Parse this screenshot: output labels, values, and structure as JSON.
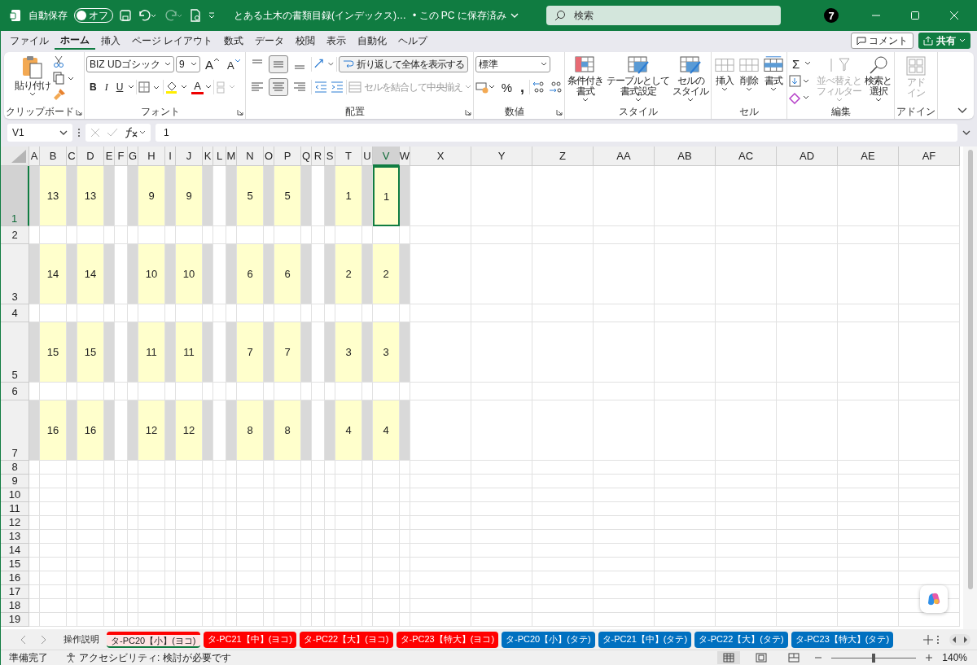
{
  "title_bar": {
    "autosave_label": "自動保存",
    "autosave_toggle": {
      "label": "オフ",
      "on": false
    },
    "document_title": "とある土木の書類目録(インデックス)…",
    "save_status": "• この PC に保存済み",
    "search_placeholder": "検索",
    "badge": "7"
  },
  "menu_tabs": [
    {
      "label": "ファイル",
      "selected": false
    },
    {
      "label": "ホーム",
      "selected": true
    },
    {
      "label": "挿入",
      "selected": false
    },
    {
      "label": "ページ レイアウト",
      "selected": false
    },
    {
      "label": "数式",
      "selected": false
    },
    {
      "label": "データ",
      "selected": false
    },
    {
      "label": "校閲",
      "selected": false
    },
    {
      "label": "表示",
      "selected": false
    },
    {
      "label": "自動化",
      "selected": false
    },
    {
      "label": "ヘルプ",
      "selected": false
    }
  ],
  "comment_button": "コメント",
  "share_button": "共有",
  "ribbon": {
    "clipboard": {
      "label": "クリップボード",
      "paste": "貼り付け"
    },
    "font": {
      "label": "フォント",
      "font_name": "BIZ UDゴシック",
      "font_size": "9",
      "grow": "A",
      "shrink": "A",
      "style_buttons": [
        "B",
        "I",
        "U"
      ],
      "font_color": "A"
    },
    "alignment": {
      "label": "配置",
      "vertical": [
        {
          "selected": false
        },
        {
          "selected": true
        },
        {
          "selected": false
        }
      ],
      "horizontal": [
        {
          "selected": false
        },
        {
          "selected": true
        },
        {
          "selected": false
        }
      ],
      "wrap": "折り返して全体を表示する",
      "merge": {
        "label": "セルを結合して中央揃え",
        "disabled": true
      }
    },
    "number": {
      "label": "数値",
      "format": "標準",
      "percent": "%",
      "comma": ","
    },
    "styles": {
      "label": "スタイル",
      "buttons": [
        {
          "lines": [
            "条件付き",
            "書式"
          ]
        },
        {
          "lines": [
            "テーブルとして",
            "書式設定"
          ]
        },
        {
          "lines": [
            "セルの",
            "スタイル"
          ]
        }
      ]
    },
    "cells": {
      "label": "セル",
      "buttons": [
        "挿入",
        "削除",
        "書式"
      ]
    },
    "editing": {
      "label": "編集",
      "sigma": "Σ",
      "sort": {
        "lines": [
          "並べ替えと",
          "フィルター"
        ],
        "disabled": true
      },
      "find": {
        "lines": [
          "検索と",
          "選択"
        ],
        "disabled": false
      }
    },
    "addins": {
      "label": "アドイン",
      "button": {
        "lines": [
          "アド",
          "イン"
        ],
        "disabled": true
      }
    }
  },
  "formula_bar": {
    "name_box": "V1",
    "formula": "1"
  },
  "sheet": {
    "columns": [
      {
        "label": "A",
        "kind": "gray",
        "selected": false
      },
      {
        "label": "B",
        "kind": "yellow",
        "selected": false
      },
      {
        "label": "C",
        "kind": "gray",
        "selected": false
      },
      {
        "label": "D",
        "kind": "yellow",
        "selected": false
      },
      {
        "label": "E",
        "kind": "gray",
        "selected": false
      },
      {
        "label": "F",
        "kind": "white",
        "selected": false
      },
      {
        "label": "G",
        "kind": "gray",
        "selected": false
      },
      {
        "label": "H",
        "kind": "yellow",
        "selected": false
      },
      {
        "label": "I",
        "kind": "gray",
        "selected": false
      },
      {
        "label": "J",
        "kind": "yellow",
        "selected": false
      },
      {
        "label": "K",
        "kind": "gray",
        "selected": false
      },
      {
        "label": "L",
        "kind": "white",
        "selected": false
      },
      {
        "label": "M",
        "kind": "gray",
        "selected": false
      },
      {
        "label": "N",
        "kind": "yellow",
        "selected": false
      },
      {
        "label": "O",
        "kind": "gray",
        "selected": false
      },
      {
        "label": "P",
        "kind": "yellow",
        "selected": false
      },
      {
        "label": "Q",
        "kind": "gray",
        "selected": false
      },
      {
        "label": "R",
        "kind": "white",
        "selected": false
      },
      {
        "label": "S",
        "kind": "gray",
        "selected": false
      },
      {
        "label": "T",
        "kind": "yellow",
        "selected": false
      },
      {
        "label": "U",
        "kind": "gray",
        "selected": false
      },
      {
        "label": "V",
        "kind": "yellow",
        "selected": true
      },
      {
        "label": "W",
        "kind": "gray",
        "selected": false
      },
      {
        "label": "X",
        "kind": "plain",
        "selected": false
      },
      {
        "label": "Y",
        "kind": "plain",
        "selected": false
      },
      {
        "label": "Z",
        "kind": "plain",
        "selected": false
      },
      {
        "label": "AA",
        "kind": "plain",
        "selected": false
      },
      {
        "label": "AB",
        "kind": "plain",
        "selected": false
      },
      {
        "label": "AC",
        "kind": "plain",
        "selected": false
      },
      {
        "label": "AD",
        "kind": "plain",
        "selected": false
      },
      {
        "label": "AE",
        "kind": "plain",
        "selected": false
      },
      {
        "label": "AF",
        "kind": "plain",
        "selected": false
      }
    ],
    "rows": [
      {
        "label": "1",
        "kind": "tall",
        "selected": true,
        "values": [
          "13",
          "13",
          "9",
          "9",
          "5",
          "5",
          "1",
          "1"
        ]
      },
      {
        "label": "2",
        "kind": "short",
        "selected": false
      },
      {
        "label": "3",
        "kind": "tall",
        "selected": false,
        "values": [
          "14",
          "14",
          "10",
          "10",
          "6",
          "6",
          "2",
          "2"
        ]
      },
      {
        "label": "4",
        "kind": "short",
        "selected": false
      },
      {
        "label": "5",
        "kind": "tall",
        "selected": false,
        "values": [
          "15",
          "15",
          "11",
          "11",
          "7",
          "7",
          "3",
          "3"
        ]
      },
      {
        "label": "6",
        "kind": "short",
        "selected": false
      },
      {
        "label": "7",
        "kind": "tall",
        "selected": false,
        "values": [
          "16",
          "16",
          "12",
          "12",
          "8",
          "8",
          "4",
          "4"
        ]
      },
      {
        "label": "8",
        "kind": "normal",
        "selected": false
      },
      {
        "label": "9",
        "kind": "normal",
        "selected": false
      },
      {
        "label": "10",
        "kind": "normal",
        "selected": false
      },
      {
        "label": "11",
        "kind": "normal",
        "selected": false
      },
      {
        "label": "12",
        "kind": "normal",
        "selected": false
      },
      {
        "label": "13",
        "kind": "normal",
        "selected": false
      },
      {
        "label": "14",
        "kind": "normal",
        "selected": false
      },
      {
        "label": "15",
        "kind": "normal",
        "selected": false
      },
      {
        "label": "16",
        "kind": "normal",
        "selected": false
      },
      {
        "label": "17",
        "kind": "normal",
        "selected": false
      },
      {
        "label": "18",
        "kind": "normal",
        "selected": false
      },
      {
        "label": "19",
        "kind": "normal",
        "selected": false
      }
    ]
  },
  "sheet_tabs": [
    {
      "label": "操作説明",
      "selected": false
    },
    {
      "label": "タ-PC20【小】(ヨコ)",
      "selected": true,
      "color": "#ff0000"
    },
    {
      "label": "タ-PC21【中】(ヨコ)",
      "selected": false,
      "color": "#ff0000"
    },
    {
      "label": "タ-PC22【大】(ヨコ)",
      "selected": false,
      "color": "#ff0000"
    },
    {
      "label": "タ-PC23【特大】(ヨコ)",
      "selected": false,
      "color": "#ff0000"
    },
    {
      "label": "タ-PC20【小】(タテ)",
      "selected": false,
      "color": "#0070c0"
    },
    {
      "label": "タ-PC21【中】(タテ)",
      "selected": false,
      "color": "#0070c0"
    },
    {
      "label": "タ-PC22【大】(タテ)",
      "selected": false,
      "color": "#0070c0"
    },
    {
      "label": "タ-PC23【特大】(タテ)",
      "selected": false,
      "color": "#0070c0"
    }
  ],
  "status_bar": {
    "ready": "準備完了",
    "accessibility": "アクセシビリティ: 検討が必要です",
    "views": [
      {
        "selected": true
      },
      {
        "selected": false
      },
      {
        "selected": false
      }
    ],
    "zoom": {
      "level": 0.5,
      "label": "140%"
    }
  }
}
